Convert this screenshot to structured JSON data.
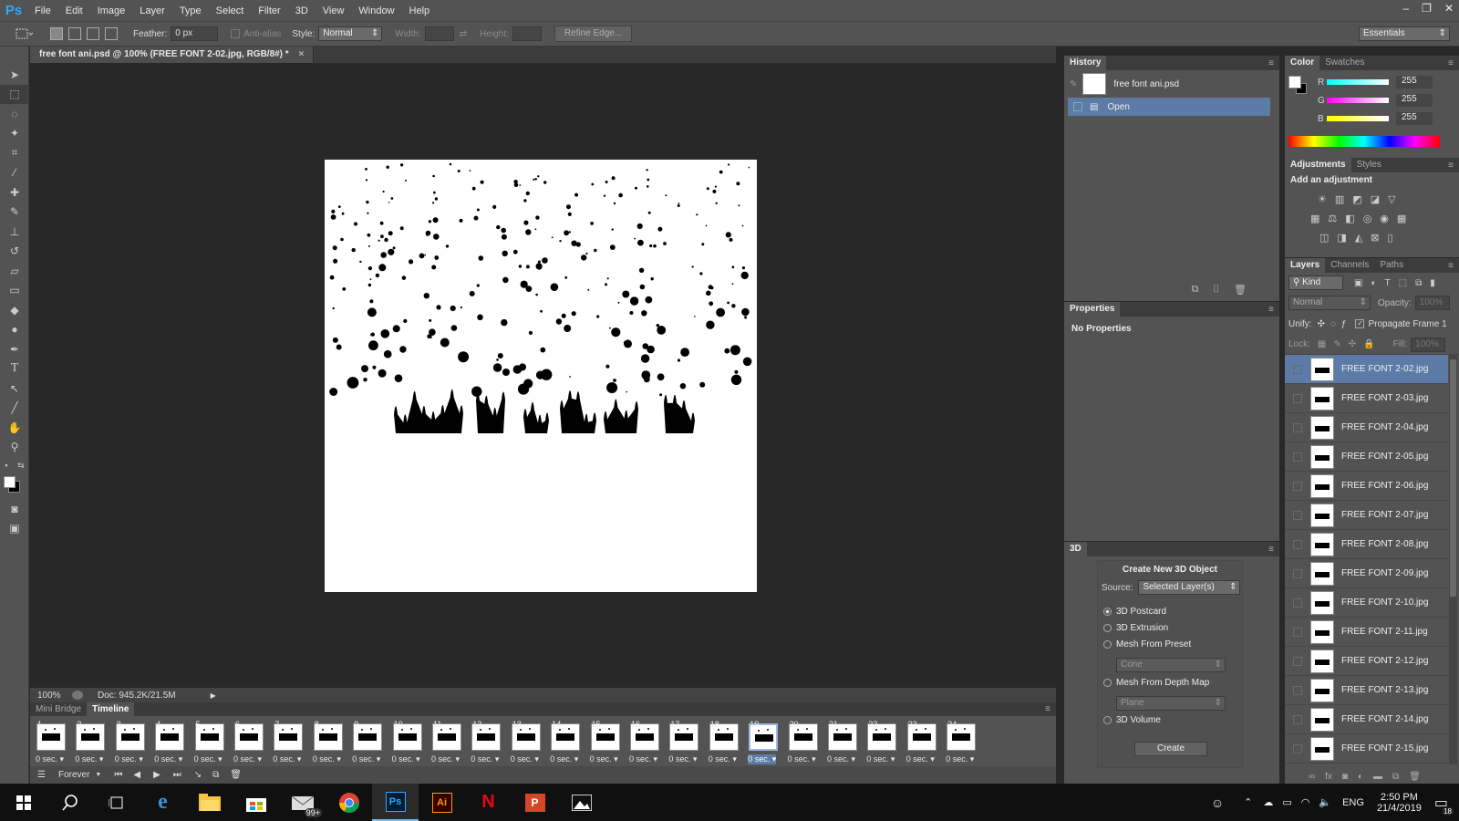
{
  "app": {
    "logo": "Ps",
    "menu": [
      "File",
      "Edit",
      "Image",
      "Layer",
      "Type",
      "Select",
      "Filter",
      "3D",
      "View",
      "Window",
      "Help"
    ],
    "window_controls": [
      "–",
      "❐",
      "✕"
    ]
  },
  "options_bar": {
    "feather_label": "Feather:",
    "feather_value": "0 px",
    "antialias_label": "Anti-alias",
    "style_label": "Style:",
    "style_value": "Normal",
    "width_label": "Width:",
    "height_label": "Height:",
    "refine_edge": "Refine Edge...",
    "workspace": "Essentials"
  },
  "document": {
    "tab_title": "free font ani.psd @ 100% (FREE FONT 2-02.jpg, RGB/8#) *",
    "zoom": "100%",
    "doc_info": "Doc: 945.2K/21.5M"
  },
  "timeline": {
    "tabs": [
      "Mini Bridge",
      "Timeline"
    ],
    "active_tab": "Timeline",
    "frames": [
      {
        "num": "1",
        "delay": "0 sec."
      },
      {
        "num": "2",
        "delay": "0 sec."
      },
      {
        "num": "3",
        "delay": "0 sec."
      },
      {
        "num": "4",
        "delay": "0 sec."
      },
      {
        "num": "5",
        "delay": "0 sec."
      },
      {
        "num": "6",
        "delay": "0 sec."
      },
      {
        "num": "7",
        "delay": "0 sec."
      },
      {
        "num": "8",
        "delay": "0 sec."
      },
      {
        "num": "9",
        "delay": "0 sec."
      },
      {
        "num": "10",
        "delay": "0 sec."
      },
      {
        "num": "11",
        "delay": "0 sec."
      },
      {
        "num": "12",
        "delay": "0 sec."
      },
      {
        "num": "13",
        "delay": "0 sec."
      },
      {
        "num": "14",
        "delay": "0 sec."
      },
      {
        "num": "15",
        "delay": "0 sec."
      },
      {
        "num": "16",
        "delay": "0 sec."
      },
      {
        "num": "17",
        "delay": "0 sec."
      },
      {
        "num": "18",
        "delay": "0 sec."
      },
      {
        "num": "19",
        "delay": "0 sec."
      },
      {
        "num": "20",
        "delay": "0 sec."
      },
      {
        "num": "21",
        "delay": "0 sec."
      },
      {
        "num": "22",
        "delay": "0 sec."
      },
      {
        "num": "23",
        "delay": "0 sec."
      },
      {
        "num": "24",
        "delay": "0 sec."
      }
    ],
    "selected_frame": "19",
    "loop": "Forever"
  },
  "history": {
    "title": "History",
    "snapshot": "free font ani.psd",
    "items": [
      "Open"
    ]
  },
  "properties": {
    "title": "Properties",
    "message": "No Properties"
  },
  "threed": {
    "title": "3D",
    "heading": "Create New 3D Object",
    "source_label": "Source:",
    "source_value": "Selected Layer(s)",
    "options": [
      "3D Postcard",
      "3D Extrusion",
      "Mesh From Preset",
      "Mesh From Depth Map",
      "3D Volume"
    ],
    "preset_value": "Cone",
    "depth_value": "Plane",
    "create_button": "Create"
  },
  "color": {
    "tabs": [
      "Color",
      "Swatches"
    ],
    "r_label": "R",
    "r_value": "255",
    "g_label": "G",
    "g_value": "255",
    "b_label": "B",
    "b_value": "255"
  },
  "adjustments": {
    "tabs": [
      "Adjustments",
      "Styles"
    ],
    "heading": "Add an adjustment"
  },
  "layers": {
    "tabs": [
      "Layers",
      "Channels",
      "Paths"
    ],
    "kind": "Kind",
    "blend_mode": "Normal",
    "opacity_label": "Opacity:",
    "opacity_value": "100%",
    "unify_label": "Unify:",
    "propagate_label": "Propagate Frame 1",
    "lock_label": "Lock:",
    "fill_label": "Fill:",
    "fill_value": "100%",
    "items": [
      "FREE FONT 2-02.jpg",
      "FREE FONT 2-03.jpg",
      "FREE FONT 2-04.jpg",
      "FREE FONT 2-05.jpg",
      "FREE FONT 2-06.jpg",
      "FREE FONT 2-07.jpg",
      "FREE FONT 2-08.jpg",
      "FREE FONT 2-09.jpg",
      "FREE FONT 2-10.jpg",
      "FREE FONT 2-11.jpg",
      "FREE FONT 2-12.jpg",
      "FREE FONT 2-13.jpg",
      "FREE FONT 2-14.jpg",
      "FREE FONT 2-15.jpg"
    ]
  },
  "taskbar": {
    "mail_badge": "99+",
    "language": "ENG",
    "time": "2:50 PM",
    "date": "21/4/2019",
    "notifications": "18"
  }
}
